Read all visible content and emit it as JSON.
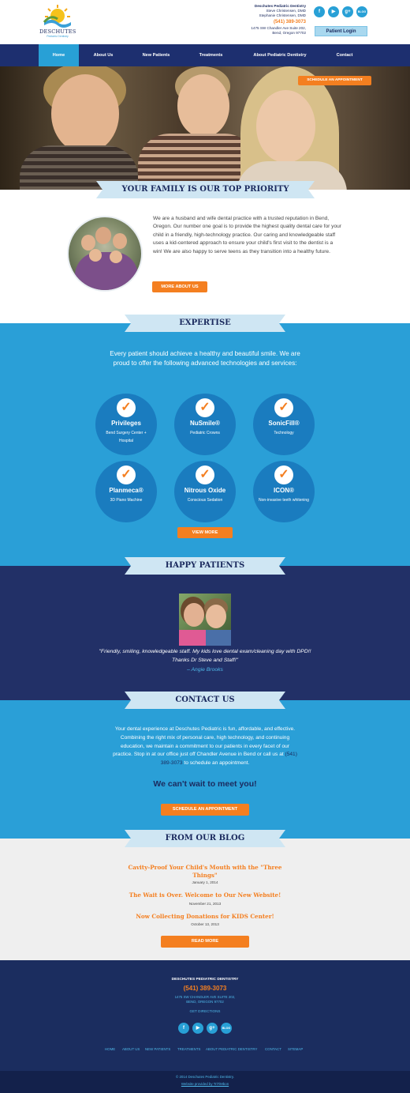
{
  "header": {
    "logo_text": "DESCHUTES",
    "logo_subtext": "Pediatric Dentistry",
    "practice": "Deschutes Pediatric Dentistry",
    "doctor1": "Steve Christensen, DMD",
    "doctor2": "Stephanie Christensen, DMD",
    "phone": "(541) 389-3073",
    "address1": "1475 SW Chandler Ave Suite 202,",
    "address2": "Bend, Oregon 97702",
    "patient_login": "Patient Login",
    "social": [
      "f",
      "▶",
      "g+",
      "BLOG"
    ]
  },
  "nav": {
    "items": [
      "Home",
      "About Us",
      "New Patients",
      "Treatments",
      "About Pediatric Dentistry",
      "Contact"
    ]
  },
  "hero": {
    "schedule_label": "SCHEDULE AN APPOINTMENT"
  },
  "family": {
    "title": "YOUR FAMILY IS OUR TOP PRIORITY",
    "text": "We are a husband and wife dental practice with a trusted reputation in Bend, Oregon. Our number one goal is to provide the highest quality dental care for your child in a friendly, high-technology practice. Our caring and knowledgeable staff uses a kid-centered approach to ensure your child's first visit to the dentist is a win! We are also happy to serve teens as they transition into a healthy future.",
    "button": "MORE ABOUT US"
  },
  "expertise": {
    "title": "EXPERTISE",
    "intro": "Every patient should achieve a healthy and beautiful smile. We are proud to offer the following advanced technologies and services:",
    "items": [
      {
        "title": "Privileges",
        "sub": "Bend Surgery Center + Hospital"
      },
      {
        "title": "NuSmile®",
        "sub": "Pediatric Crowns"
      },
      {
        "title": "SonicFill®",
        "sub": "Technology"
      },
      {
        "title": "Planmeca®",
        "sub": "3D Piano Machine"
      },
      {
        "title": "Nitrous Oxide",
        "sub": "Conscious Sedation"
      },
      {
        "title": "ICON®",
        "sub": "Non-invasive teeth whitening"
      }
    ],
    "button": "VIEW MORE"
  },
  "patients": {
    "title": "HAPPY PATIENTS",
    "quote": "\"Friendly, smiling, knowledgeable staff. My kids love dental exam/cleaning day with DPD!! Thanks Dr Steve and Staff!\"",
    "author": "– Angie Brooks"
  },
  "contact": {
    "title": "CONTACT US",
    "text_before": "Your dental experience at Deschutes Pediatric is fun, affordable, and effective. Combining the right mix of personal care, high technology, and continuing education, we maintain a commitment to our patients in every facet of our practice. Stop in at our office just off Chandler Avenue in Bend or call us at ",
    "phone": "(541) 389-3073",
    "text_after": " to schedule an appointment.",
    "headline": "We can't wait to meet you!",
    "button": "SCHEDULE AN APPOINTMENT"
  },
  "blog": {
    "title": "FROM OUR BLOG",
    "posts": [
      {
        "title": "Cavity-Proof Your Child's Mouth with the \"Three Things\"",
        "date": "January 1, 2014"
      },
      {
        "title": "The Wait is Over. Welcome to Our New Website!",
        "date": "November 21, 2013"
      },
      {
        "title": "Now Collecting Donations for KIDS Center!",
        "date": "October 13, 2013"
      }
    ],
    "button": "READ MORE"
  },
  "footer": {
    "name": "DESCHUTES PEDIATRIC DENTISTRY",
    "phone": "(541) 389-3073",
    "address1": "1475 SW CHANDLER AVE SUITE 202,",
    "address2": "BEND, OREGON 97702",
    "directions": "GET DIRECTIONS",
    "links": [
      "HOME",
      "ABOUT US",
      "NEW PATIENTS",
      "TREATMENTS",
      "ABOUT PEDIATRIC DENTISTRY",
      "CONTACT",
      "SITEMAP"
    ],
    "copyright": "© 2014 Deschutes Pediatric Dentistry.",
    "credit": "Website provided by TriTiMbon"
  },
  "colors": {
    "navy": "#1d2f6f",
    "blue": "#2a9fd7",
    "orange": "#f47f20",
    "ribbon": "#cfe6f3"
  }
}
